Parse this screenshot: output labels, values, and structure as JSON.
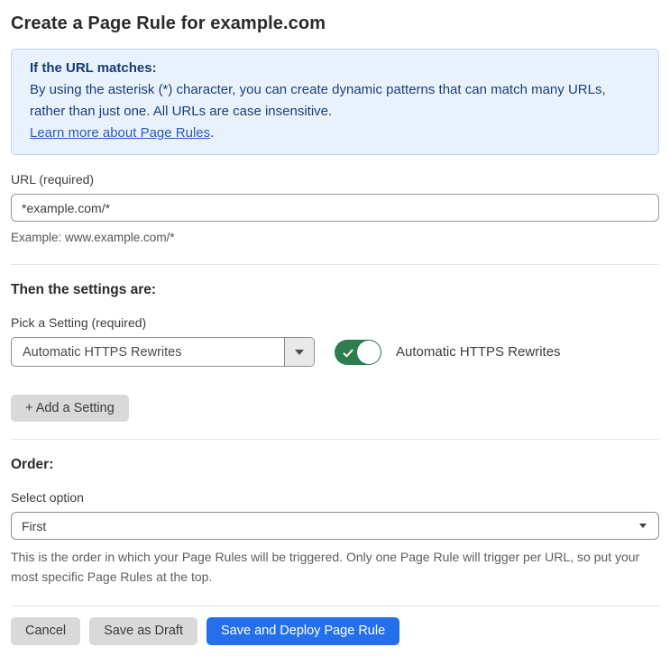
{
  "page": {
    "title": "Create a Page Rule for example.com"
  },
  "info_box": {
    "heading": "If the URL matches:",
    "body": "By using the asterisk (*) character, you can create dynamic patterns that can match many URLs, rather than just one. All URLs are case insensitive.",
    "link": "Learn more about Page Rules",
    "link_suffix": "."
  },
  "url_field": {
    "label": "URL (required)",
    "value": "*example.com/*",
    "helper": "Example: www.example.com/*"
  },
  "settings_section": {
    "heading": "Then the settings are:",
    "picker_label": "Pick a Setting (required)",
    "picker_value": "Automatic HTTPS Rewrites",
    "toggle_label": "Automatic HTTPS Rewrites",
    "toggle_state": "on",
    "add_setting_button": "+ Add a Setting"
  },
  "order_section": {
    "heading": "Order:",
    "select_label": "Select option",
    "select_value": "First",
    "helper": "This is the order in which your Page Rules will be triggered. Only one Page Rule will trigger per URL, so put your most specific Page Rules at the top."
  },
  "footer": {
    "cancel_label": "Cancel",
    "save_draft_label": "Save as Draft",
    "save_deploy_label": "Save and Deploy Page Rule"
  },
  "icons": {
    "combo_arrow": "dropdown-arrow-icon",
    "select_arrow": "chevron-down-icon",
    "toggle_check": "check-icon"
  },
  "colors": {
    "primary_button_blue": "#2470ea",
    "toggle_green": "#2d7d4e",
    "info_background": "#e9f2fc",
    "info_border": "#bcd6f1",
    "info_text": "#1d3d78",
    "link_blue": "#2b5cb8",
    "gray_button": "#d9d9d9"
  }
}
